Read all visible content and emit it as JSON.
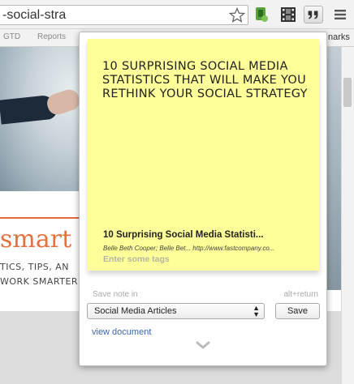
{
  "browser": {
    "url_text": "-social-stra",
    "bookmarks": [
      "GTD",
      "Reports"
    ],
    "bookmarks_overflow": "narks",
    "icons": [
      "star-icon",
      "extension-green-icon",
      "film-icon",
      "quote-icon",
      "menu-icon"
    ]
  },
  "page": {
    "brand_text": "smart",
    "tagline_lines": [
      "TICS, TIPS, AN",
      "WORK SMARTER"
    ],
    "accent_color": "#e5703f"
  },
  "popup": {
    "note_title": "10 SURPRISING SOCIAL MEDIA STATISTICS THAT WILL MAKE YOU RETHINK YOUR SOCIAL STRATEGY",
    "clip_title": "10 Surprising Social Media Statisti...",
    "clip_meta": "Belle Beth Cooper; Belle Bet... http://www.fastcompany.co...",
    "tags_placeholder": "Enter some tags",
    "save_label": "Save note in",
    "shortcut": "alt+return",
    "notebook_selected": "Social Media Articles",
    "save_button": "Save",
    "view_document": "view document",
    "note_color": "#ffff99"
  }
}
